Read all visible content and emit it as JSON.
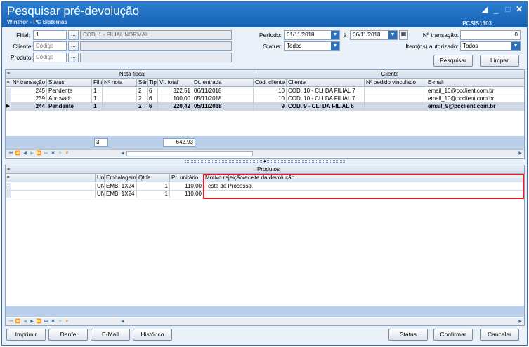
{
  "window": {
    "title": "Pesquisar pré-devolução",
    "subtitle": "Winthor - PC Sistemas",
    "routine_code": "PCSIS1303"
  },
  "filters": {
    "filial_label": "Filial:",
    "filial_value": "1",
    "filial_desc": "COD. 1 - FILIAL NORMAL",
    "cliente_label": "Cliente:",
    "cliente_placeholder": "Código",
    "produto_label": "Produto:",
    "produto_placeholder": "Código",
    "dots": "...",
    "periodo_label": "Período:",
    "periodo_start": "01/11/2018",
    "periodo_sep": "à",
    "periodo_end": "06/11/2018",
    "status_label": "Status:",
    "status_value": "Todos",
    "transacao_label": "Nº transação:",
    "transacao_value": "0",
    "autorizado_label": "Item(ns) autorizado:",
    "autorizado_value": "Todos",
    "pesquisar": "Pesquisar",
    "limpar": "Limpar"
  },
  "top_grid": {
    "band_nota": "Nota fiscal",
    "band_cliente": "Cliente",
    "columns": [
      "Nº transação",
      "Status",
      "Filial",
      "Nº nota",
      "Série",
      "Tipo",
      "Vl. total",
      "Dt. entrada",
      "Cód. cliente",
      "Cliente",
      "Nº pedido vinculado",
      "E-mail"
    ],
    "rows": [
      [
        "245",
        "Pendente",
        "1",
        "",
        "2",
        "6",
        "322,51",
        "06/11/2018",
        "10",
        "COD. 10 - CLI DA FILIAL 7",
        "",
        "email_10@pcclient.com.br"
      ],
      [
        "239",
        "Aprovado",
        "1",
        "",
        "2",
        "6",
        "100,00",
        "05/11/2018",
        "10",
        "COD. 10 - CLI DA FILIAL 7",
        "",
        "email_10@pcclient.com.br"
      ],
      [
        "244",
        "Pendente",
        "1",
        "",
        "2",
        "6",
        "220,42",
        "05/11/2018",
        "9",
        "COD. 9 - CLI DA FILIAL 6",
        "",
        "email_9@pcclient.com.br"
      ]
    ],
    "total_count": "3",
    "total_value": "642,93"
  },
  "bottom_grid": {
    "band": "Produtos",
    "columns": [
      "Unid.",
      "Embalagem",
      "Qtde.",
      "Pr. unitário",
      "Motivo rejeição/aceite da devolução"
    ],
    "rows": [
      [
        "UN",
        "EMB. 1X24",
        "1",
        "110,00",
        "Teste de Processo."
      ],
      [
        "UN",
        "EMB. 1X24",
        "1",
        "110,00",
        ""
      ]
    ]
  },
  "footer": {
    "imprimir": "Imprimir",
    "danfe": "Danfe",
    "email": "E-Mail",
    "historico": "Histórico",
    "status": "Status",
    "confirmar": "Confirmar",
    "cancelar": "Cancelar"
  },
  "colors": {
    "accent": "#1661b4",
    "highlight_border": "#e0202a"
  }
}
